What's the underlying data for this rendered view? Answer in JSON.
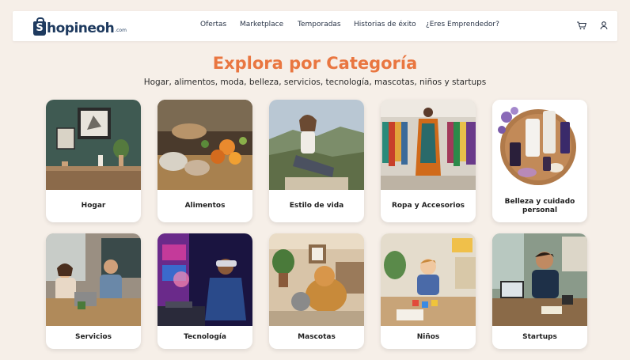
{
  "brand": {
    "logo_letter": "S",
    "name": "hopineoh",
    "suffix": ".com"
  },
  "nav": [
    {
      "label": "Ofertas"
    },
    {
      "label": "Marketplace"
    },
    {
      "label": "Temporadas"
    },
    {
      "label": "Historias de éxito"
    },
    {
      "label": "¿Eres Emprendedor?"
    }
  ],
  "header_icons": [
    "cart-icon",
    "user-icon"
  ],
  "hero": {
    "title": "Explora por Categoría",
    "subtitle": "Hogar, alimentos, moda, belleza, servicios, tecnología, mascotas, niños y startups"
  },
  "categories": [
    {
      "label": "Hogar"
    },
    {
      "label": "Alimentos"
    },
    {
      "label": "Estilo de vida"
    },
    {
      "label": "Ropa y Accesorios"
    },
    {
      "label": "Belleza y cuidado personal"
    },
    {
      "label": "Servicios"
    },
    {
      "label": "Tecnología"
    },
    {
      "label": "Mascotas"
    },
    {
      "label": "Niños"
    },
    {
      "label": "Startups"
    }
  ],
  "colors": {
    "accent": "#e97640",
    "brand": "#1e3a5f",
    "background": "#f6efe8"
  }
}
